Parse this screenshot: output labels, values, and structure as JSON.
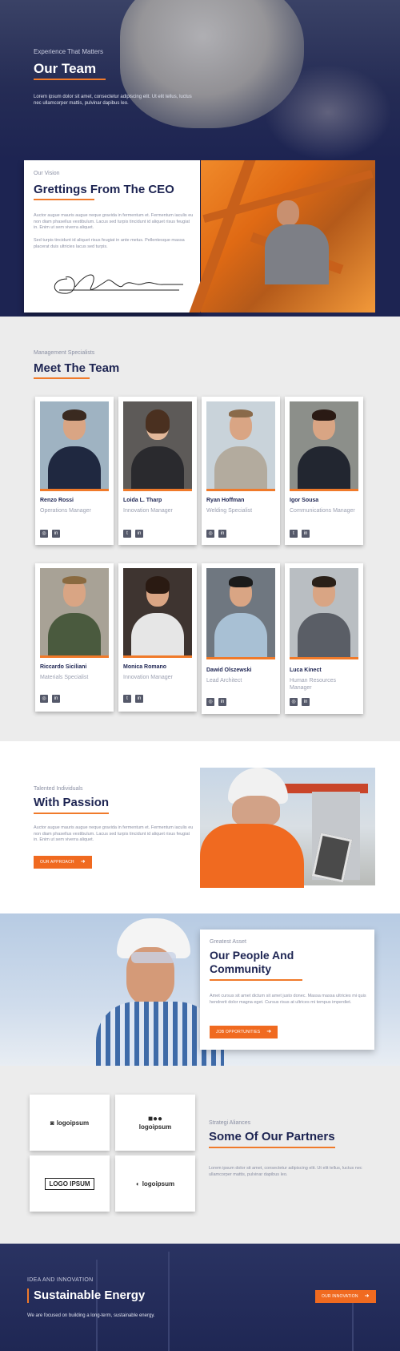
{
  "hero": {
    "kicker": "Experience That Matters",
    "title": "Our Team",
    "text": "Lorem ipsum dolor sit amet, consectetur adipiscing elit. Ut elit tellus, luctus nec ullamcorper mattis, pulvinar dapibus leo."
  },
  "ceo": {
    "kicker": "Our Vision",
    "title": "Grettings From The CEO",
    "p1": "Auctor augue mauris augue neque gravida in fermentum et. Fermentum iaculis eu non diam phasellus vestibulum. Lacus sed turpis tincidunt id aliquet risus feugiat in. Enim ut sem viverra aliquet.",
    "p2": "Sed turpis tincidunt id aliquet risus feugiat in ante metus. Pellentesque massa placerat duis ultricies lacus sed turpis."
  },
  "team": {
    "kicker": "Management Specialists",
    "title": "Meet The Team",
    "members": [
      {
        "name": "Renzo Rossi",
        "role": "Operations Manager"
      },
      {
        "name": "Loida L. Tharp",
        "role": "Innovation Manager"
      },
      {
        "name": "Ryan Hoffman",
        "role": "Welding Specialist"
      },
      {
        "name": "Igor Sousa",
        "role": "Communications Manager"
      },
      {
        "name": "Riccardo Siciliani",
        "role": "Materials Specialist"
      },
      {
        "name": "Monica Romano",
        "role": "Innovation Manager"
      },
      {
        "name": "Dawid Olszewski",
        "role": "Lead Architect"
      },
      {
        "name": "Luca Kinect",
        "role": "Human Resources Manager"
      }
    ]
  },
  "passion": {
    "kicker": "Talented Individuals",
    "title": "With Passion",
    "text": "Auctor augue mauris augue neque gravida in fermentum et. Fermentum iaculis eu non diam phasellus vestibulum. Lacus sed turpis tincidunt id aliquet risus feugiat in. Enim ut sem viverra aliquet.",
    "button": "OUR APPROACH"
  },
  "people": {
    "kicker": "Greatest Asset",
    "title": "Our People And Community",
    "text": "Amet cursus sit amet dictum sit amet justo donec. Massa massa ultricies mi quis hendrerit dolor magna eget. Cursus risus at ultrices mi tempus imperdiet.",
    "button": "JOB OPPORTUNITIES"
  },
  "partners": {
    "kicker": "Strategi Aliances",
    "title": "Some Of Our Partners",
    "text": "Lorem ipsum dolor sit amet, consectetur adipiscing elit. Ut elit tellus, luctus nec ullamcorper mattis, pulvinar dapibus leo.",
    "logos": [
      "logoipsum",
      "logoipsum",
      "LOGO IPSUM",
      "logoipsum"
    ]
  },
  "energy": {
    "kicker": "IDEA AND INNOVATION",
    "title_light": "Sustainable",
    "title_bold": "Energy",
    "text": "We are focused on building a long-term, sustainable energy.",
    "button": "OUR INNOVATION"
  },
  "colors": {
    "navy": "#1d2452",
    "accent": "#f07a2a"
  }
}
